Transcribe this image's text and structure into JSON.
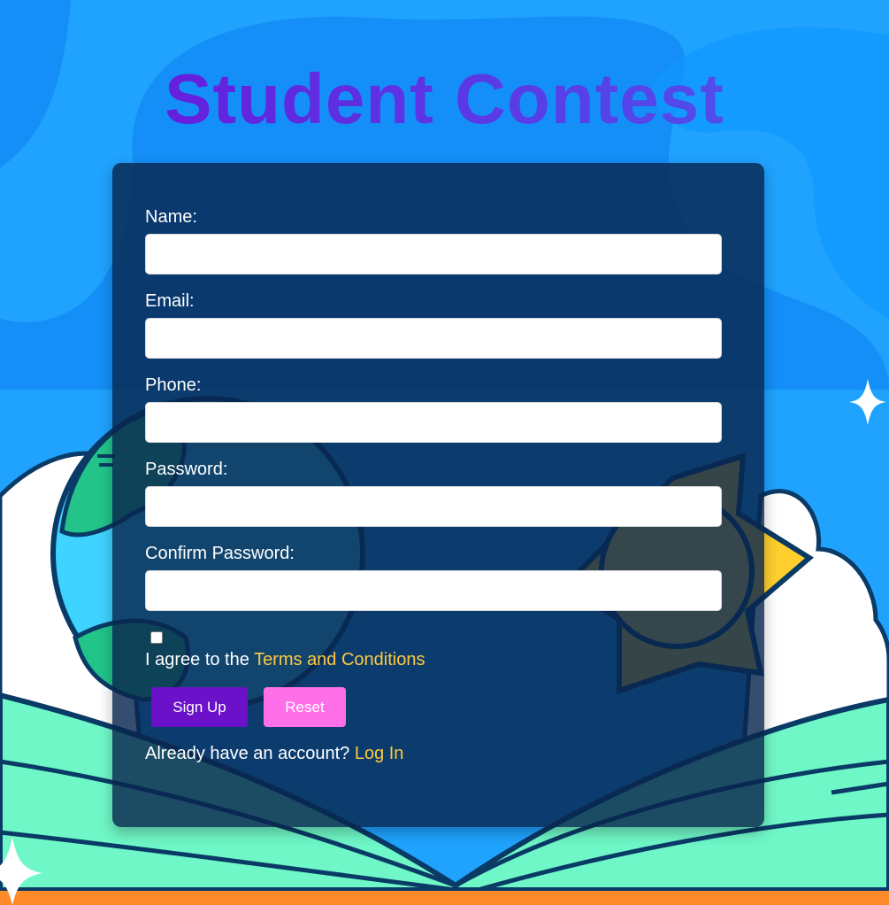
{
  "page": {
    "title": "Student Contest"
  },
  "form": {
    "fields": [
      {
        "label": "Name:",
        "value": "",
        "placeholder": ""
      },
      {
        "label": "Email:",
        "value": "",
        "placeholder": ""
      },
      {
        "label": "Phone:",
        "value": "",
        "placeholder": ""
      },
      {
        "label": "Password:",
        "value": "",
        "placeholder": ""
      },
      {
        "label": "Confirm Password:",
        "value": "",
        "placeholder": ""
      }
    ],
    "agree": {
      "checked": false,
      "text": "I agree to the ",
      "link_label": "Terms and Conditions"
    },
    "buttons": {
      "signup_label": "Sign Up",
      "reset_label": "Reset"
    },
    "login": {
      "text": "Already have an account? ",
      "link_label": "Log In"
    }
  },
  "colors": {
    "sky": "#1fa3ff",
    "card": "#08264e",
    "accent_link": "#ffc93d",
    "signup_button": "#6a11c9",
    "reset_button": "#ff70e8",
    "title_gradient_start": "#6a11d8",
    "title_gradient_end": "#4a59ec"
  },
  "background_icons": [
    "globe-icon",
    "sun-icon",
    "cloud-icon",
    "open-book-icon",
    "sparkle-icon"
  ]
}
